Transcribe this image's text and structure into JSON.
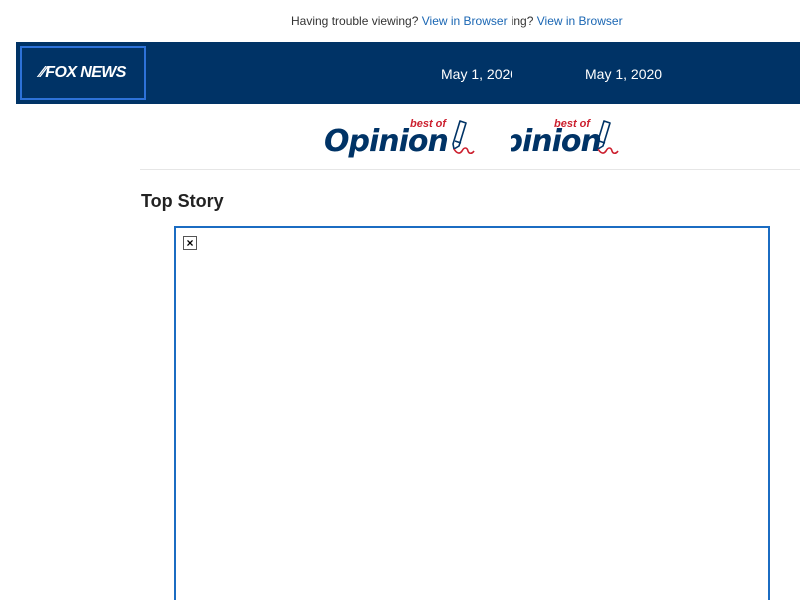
{
  "preheader": {
    "trouble_text": "Having trouble viewing?",
    "link_text": "View in Browser"
  },
  "header": {
    "logo_text": "FOX NEWS",
    "date": "May 1, 2020",
    "background_color": "#003366",
    "logo_border_color": "#2d72d9"
  },
  "banner": {
    "best_of": "best of",
    "word": "Opinion",
    "icon": "pen-icon"
  },
  "main": {
    "section_title": "Top Story",
    "story_image_icon": "broken-image-icon",
    "frame_border_color": "#1b6cc2"
  },
  "colors": {
    "link": "#1a66b3",
    "accent_red": "#cc1f2e"
  }
}
